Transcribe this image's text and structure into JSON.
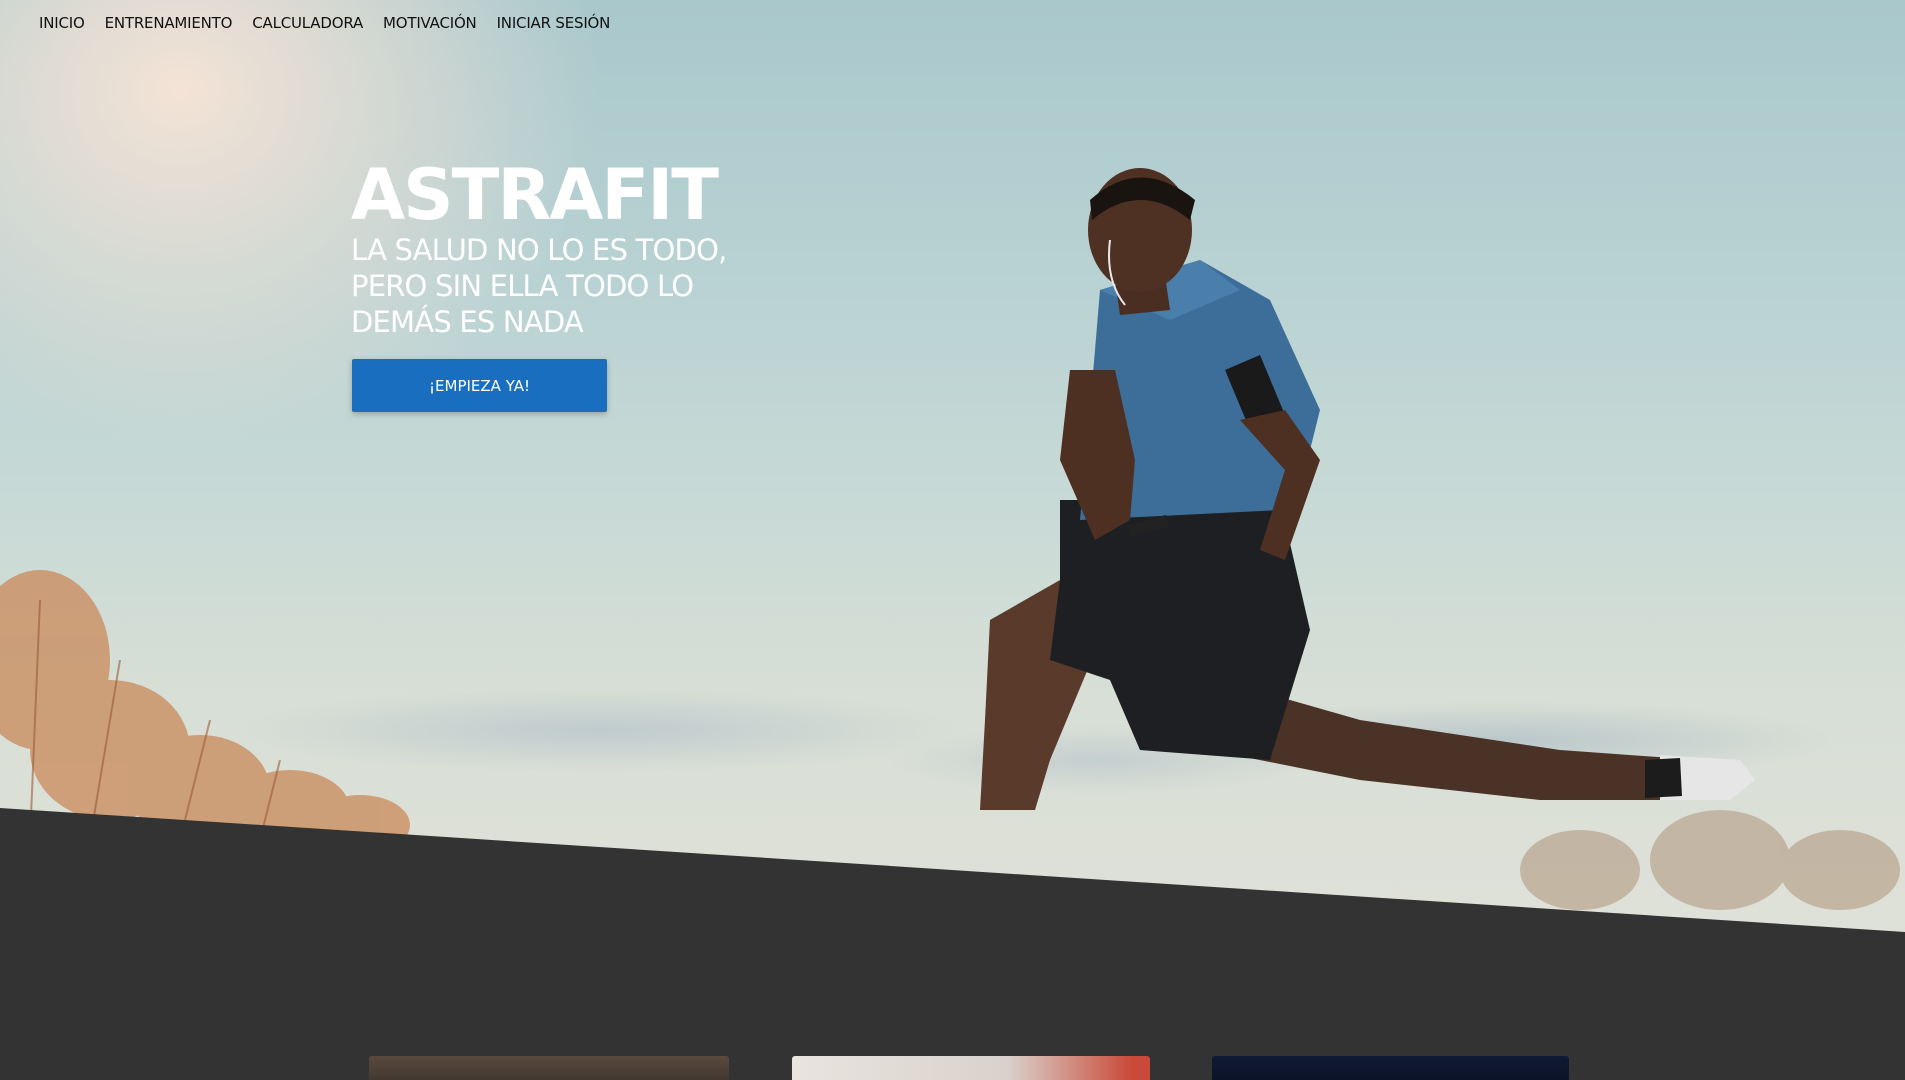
{
  "nav": {
    "items": [
      {
        "label": "INICIO"
      },
      {
        "label": "ENTRENAMIENTO"
      },
      {
        "label": "CALCULADORA"
      },
      {
        "label": "MOTIVACIÓN"
      },
      {
        "label": "INICIAR SESIÓN"
      }
    ]
  },
  "hero": {
    "brand": "ASTRAFIT",
    "tagline": "LA SALUD NO LO ES TODO, PERO SIN ELLA TODO LO DEMÁS ES NADA",
    "cta_label": "¡EMPIEZA YA!"
  },
  "colors": {
    "accent": "#1a6ebf",
    "dark_section": "#333333",
    "hero_text": "#ffffff",
    "nav_text": "#111111"
  },
  "icons": [
    "athlete-photo",
    "hero-background"
  ]
}
